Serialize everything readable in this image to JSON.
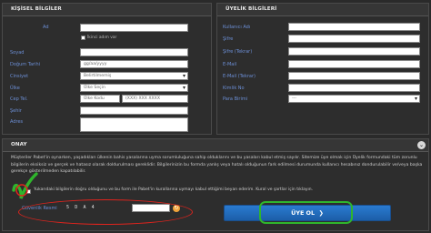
{
  "personal": {
    "title": "KİŞİSEL BİLGİLER",
    "labels": [
      "Ad",
      "Soyad",
      "Doğum Tarihi",
      "Cinsiyet",
      "Ülke",
      "Cep Tel.",
      "Şehir",
      "Adres"
    ],
    "values": {
      "ad": "",
      "second_name_checkbox": "İkinci adım var",
      "soyad": "",
      "dogum_tarihi": "gg/aa/yyyy",
      "cinsiyet": "Belirtilmemiş",
      "ulke": "Ülke Seçin",
      "cep_kod": "Ülke Kodu",
      "cep_tel": "(XXX) XXX XXXX",
      "sehir": "",
      "adres": ""
    }
  },
  "membership": {
    "title": "ÜYELİK BİLGİLERİ",
    "labels": [
      "Kullanıcı Adı",
      "Şifre",
      "Şifre (Tekrar)",
      "E-Mail",
      "E-Mail (Tekrar)",
      "Kimlik No",
      "Para Birimi"
    ],
    "values": {
      "para_birimi": "---"
    }
  },
  "approval": {
    "title": "ONAY",
    "text": "Müşteriler Pabet'in oynarken, yaşadıkları ülkenin bahis yasalarına uyma sorumluluğuna sahip olduklarını ve bu yasaları kabul etmiş sayılır. Sitemize üye olmak için Üyelik formundaki tüm zorunlu bilgilerin eksiksiz ve gerçek ve hatasız olarak doldurulması gereklidir. Bilgilerinizin bu formda yanlış veya hatalı olduğunun fark edilmesi durumunda kullanıcı hesabınız dondurulabilir ve/veya başka gerekçe gösterilmeden kapatılabilir.",
    "confirm_text": "Yukarıdaki bilgilerin doğru olduğunu ve bu form ile Pabet'in kurallarına uymayı kabul ettiğimi beyan ederim. Kural ve şartlar için tıklayın.",
    "captcha_label": "Güvenlik Resmi",
    "captcha_code": "5 D A 4",
    "captcha_input": "",
    "submit_label": "ÜYE OL",
    "submit_icon": "chevron-right-icon",
    "annotation_red": "#e0241d",
    "annotation_green": "#2fb52c"
  },
  "colors": {
    "label_blue": "#6c8fd6",
    "button_blue": "#2a7bd0",
    "panel_bg": "#2d2d2d"
  }
}
